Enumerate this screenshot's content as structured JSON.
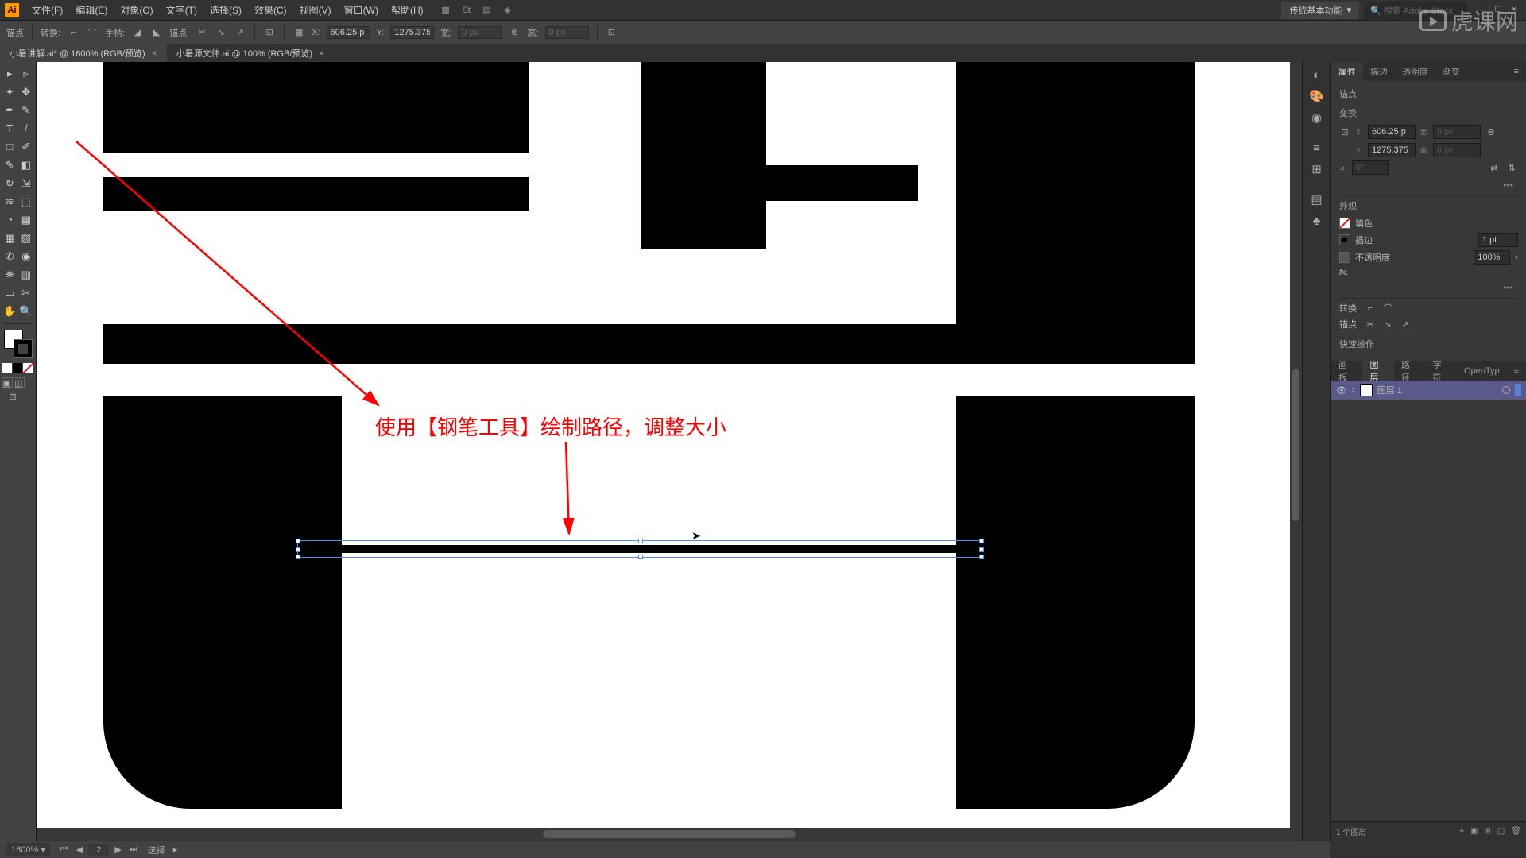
{
  "menubar": {
    "app": "Ai",
    "menus": [
      "文件(F)",
      "编辑(E)",
      "对象(O)",
      "文字(T)",
      "选择(S)",
      "效果(C)",
      "视图(V)",
      "窗口(W)",
      "帮助(H)"
    ],
    "workspace": "传统基本功能",
    "search_placeholder": "搜索 Adobe Stock"
  },
  "control": {
    "anchor_label": "锚点",
    "convert_label": "转换:",
    "handles_label": "手柄:",
    "anchors_label": "锚点:",
    "x_label": "X:",
    "y_label": "Y:",
    "x_value": "606.25 p",
    "y_value": "1275.375",
    "w_label": "宽:",
    "h_label": "高:",
    "w_value": "0 px",
    "h_value": "0 px"
  },
  "tabs": {
    "active": "小暑讲解.ai* @ 1600% (RGB/预览)",
    "inactive": "小暑源文件.ai @ 100% (RGB/预览)"
  },
  "annotation": {
    "text": "使用【钢笔工具】绘制路径，调整大小"
  },
  "panel_properties": {
    "tabs": [
      "属性",
      "描边",
      "透明度",
      "渐变"
    ],
    "heading": "锚点",
    "transform": "变换",
    "x_label": "X:",
    "y_label": "Y:",
    "x_val": "606.25 p",
    "y_val": "1275.375",
    "w_label": "宽:",
    "h_label": "高:",
    "w_val": "0 px",
    "h_val": "0 px",
    "angle_label": "⊿:",
    "angle_val": "0°",
    "appearance": "外观",
    "fill_label": "填色",
    "stroke_label": "描边",
    "stroke_val": "1 pt",
    "opacity_label": "不透明度",
    "opacity_val": "100%",
    "fx_label": "fx.",
    "convert_label": "转换:",
    "anchors_label": "锚点:",
    "quick_actions": "快速操作"
  },
  "panel_layers": {
    "tabs": [
      "画板",
      "图层",
      "路径",
      "字符",
      "OpenTyp"
    ],
    "layer_name": "图层 1",
    "footer_count": "1 个图层"
  },
  "statusbar": {
    "zoom": "1600%",
    "artboard_num": "2",
    "tool_status": "选择"
  },
  "watermark": "虎课网"
}
